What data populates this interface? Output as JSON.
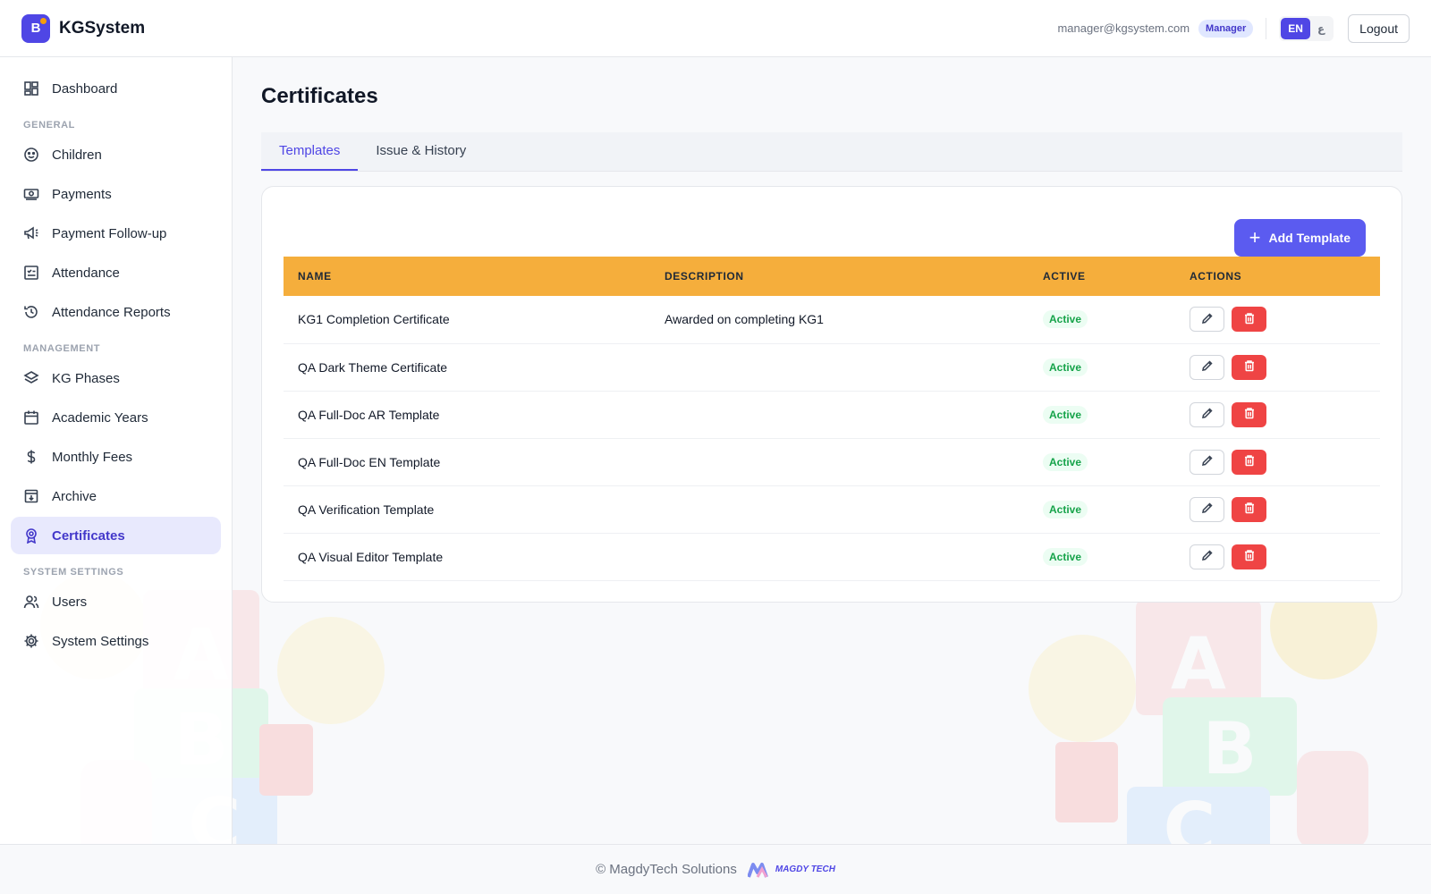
{
  "header": {
    "brand_letter": "B",
    "brand_name": "KGSystem",
    "email": "manager@kgsystem.com",
    "role": "Manager",
    "lang_en": "EN",
    "lang_ar": "ع",
    "logout_label": "Logout"
  },
  "sidebar": {
    "dashboard": "Dashboard",
    "section_general": "GENERAL",
    "children": "Children",
    "payments": "Payments",
    "payment_followup": "Payment Follow-up",
    "attendance": "Attendance",
    "attendance_reports": "Attendance Reports",
    "section_management": "MANAGEMENT",
    "kg_phases": "KG Phases",
    "academic_years": "Academic Years",
    "monthly_fees": "Monthly Fees",
    "archive": "Archive",
    "certificates": "Certificates",
    "section_system": "SYSTEM SETTINGS",
    "users": "Users",
    "system_settings": "System Settings"
  },
  "main": {
    "title": "Certificates",
    "tabs": [
      {
        "label": "Templates",
        "active": true
      },
      {
        "label": "Issue & History",
        "active": false
      }
    ],
    "add_button_label": "Add Template",
    "table": {
      "headers": [
        "NAME",
        "DESCRIPTION",
        "ACTIVE",
        "ACTIONS"
      ],
      "rows": [
        {
          "name": "KG1 Completion Certificate",
          "description": "Awarded on completing KG1",
          "status": "Active"
        },
        {
          "name": "QA Dark Theme Certificate",
          "description": "",
          "status": "Active"
        },
        {
          "name": "QA Full-Doc AR Template",
          "description": "",
          "status": "Active"
        },
        {
          "name": "QA Full-Doc EN Template",
          "description": "",
          "status": "Active"
        },
        {
          "name": "QA Verification Template",
          "description": "",
          "status": "Active"
        },
        {
          "name": "QA Visual Editor Template",
          "description": "",
          "status": "Active"
        }
      ]
    }
  },
  "footer": {
    "copyright": "© MagdyTech Solutions",
    "logo_text": "MAGDY TECH"
  },
  "colors": {
    "accent": "#4f46e5",
    "table_header": "#f5ae3c",
    "active_status": "#16a34a",
    "delete": "#ef4444"
  }
}
